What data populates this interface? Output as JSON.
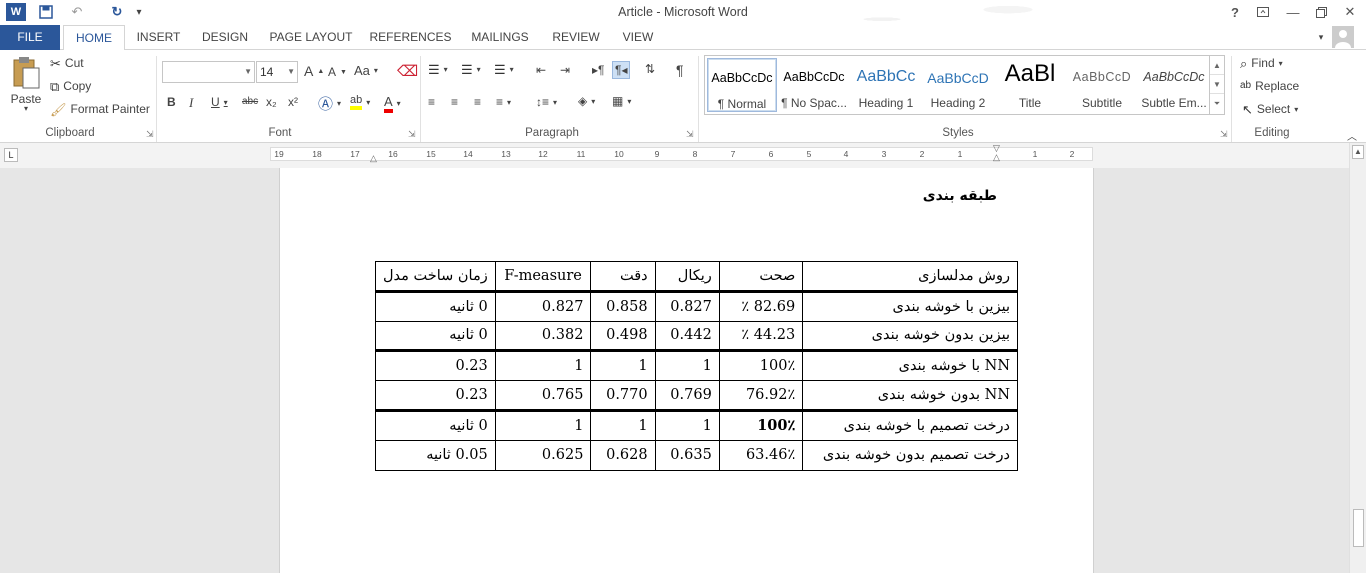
{
  "window": {
    "title": "Article - Microsoft Word",
    "help": "?",
    "min": "—",
    "restore": "🗗",
    "close": "✕"
  },
  "qat": {
    "word_logo": "W",
    "save": "💾",
    "undo": "↶",
    "redo": "↻",
    "customize": "▾"
  },
  "tabs": [
    "FILE",
    "HOME",
    "INSERT",
    "DESIGN",
    "PAGE LAYOUT",
    "REFERENCES",
    "MAILINGS",
    "REVIEW",
    "VIEW"
  ],
  "ribbon": {
    "clipboard": {
      "label": "Clipboard",
      "paste": "Paste",
      "cut": "Cut",
      "copy": "Copy",
      "format_painter": "Format Painter"
    },
    "font": {
      "label": "Font",
      "font_name": "",
      "font_size": "14",
      "grow": "A",
      "shrink": "A",
      "case": "Aa",
      "bold": "B",
      "italic": "I",
      "underline": "U",
      "strike": "abc",
      "sub": "x₂",
      "sup": "x²"
    },
    "paragraph": {
      "label": "Paragraph",
      "pilcrow": "¶"
    },
    "styles": {
      "label": "Styles",
      "items": [
        {
          "sample": "AaBbCcDc",
          "name": "¶ Normal"
        },
        {
          "sample": "AaBbCcDc",
          "name": "¶ No Spac..."
        },
        {
          "sample": "AaBbCc",
          "name": "Heading 1"
        },
        {
          "sample": "AaBbCcD",
          "name": "Heading 2"
        },
        {
          "sample": "AaBl",
          "name": "Title"
        },
        {
          "sample": "AaBbCcD",
          "name": "Subtitle"
        },
        {
          "sample": "AaBbCcDc",
          "name": "Subtle Em..."
        }
      ]
    },
    "editing": {
      "label": "Editing",
      "find": "Find",
      "replace": "Replace",
      "select": "Select"
    }
  },
  "ruler": {
    "corner": "L",
    "ticks": [
      "19",
      "18",
      "17",
      "16",
      "15",
      "14",
      "13",
      "12",
      "11",
      "10",
      "9",
      "8",
      "7",
      "6",
      "5",
      "4",
      "3",
      "2",
      "1",
      "1",
      "2"
    ]
  },
  "document": {
    "heading": "طبقه بندی",
    "table": {
      "headers": [
        "روش مدلسازی",
        "صحت",
        "ریکال",
        "دقت",
        "F-measure",
        "زمان ساخت مدل"
      ],
      "rows": [
        [
          "بیزین با خوشه بندی",
          "82.69 ٪",
          "0.827",
          "0.858",
          "0.827",
          "0 ثانیه"
        ],
        [
          "بیزین بدون خوشه بندی",
          "44.23 ٪",
          "0.442",
          "0.498",
          "0.382",
          "0 ثانیه"
        ],
        [
          "NN با خوشه بندی",
          "100٪",
          "1",
          "1",
          "1",
          "0.23"
        ],
        [
          "NN بدون خوشه بندی",
          "76.92٪",
          "0.769",
          "0.770",
          "0.765",
          "0.23"
        ],
        [
          "درخت تصمیم  با خوشه بندی",
          "100٪",
          "1",
          "1",
          "1",
          "0 ثانیه"
        ],
        [
          "درخت تصمیم بدون خوشه بندی",
          "63.46٪",
          "0.635",
          "0.628",
          "0.625",
          "0.05 ثانیه"
        ]
      ]
    }
  }
}
